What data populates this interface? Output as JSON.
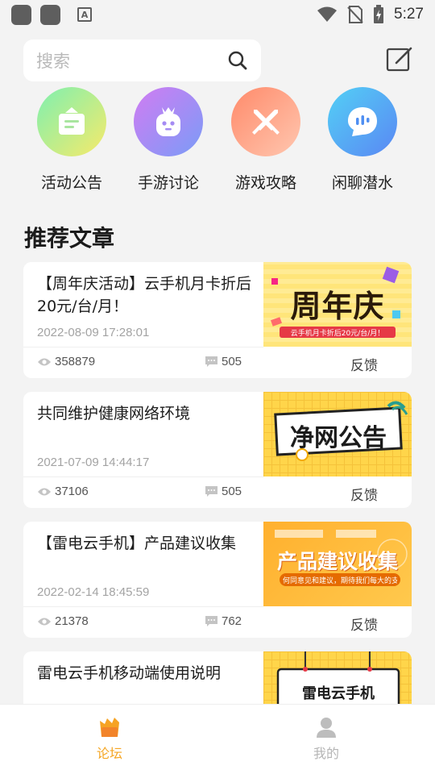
{
  "status_bar": {
    "time": "5:27"
  },
  "search": {
    "placeholder": "搜索"
  },
  "categories": [
    {
      "label": "活动公告",
      "icon": "announcement-icon",
      "colors": [
        "#8cf0a6",
        "#ffe66b"
      ]
    },
    {
      "label": "手游讨论",
      "icon": "game-mascot-icon",
      "colors": [
        "#c57cf5",
        "#7c9bf7"
      ]
    },
    {
      "label": "游戏攻略",
      "icon": "crossed-swords-icon",
      "colors": [
        "#ff9a6e",
        "#ffb9a3"
      ]
    },
    {
      "label": "闲聊潜水",
      "icon": "chat-bubble-icon",
      "colors": [
        "#4fc3f7",
        "#5b8df5"
      ]
    }
  ],
  "section_title": "推荐文章",
  "articles": [
    {
      "title": "【周年庆活动】云手机月卡折后20元/台/月！",
      "date": "2022-08-09 17:28:01",
      "views": "358879",
      "comments": "505",
      "feedback": "反馈",
      "thumb_text": "周年庆",
      "thumb_sub": "云手机月卡折后20元/台/月！"
    },
    {
      "title": "共同维护健康网络环境",
      "date": "2021-07-09 14:44:17",
      "views": "37106",
      "comments": "505",
      "feedback": "反馈",
      "thumb_text": "净网公告"
    },
    {
      "title": "【雷电云手机】产品建议收集",
      "date": "2022-02-14 18:45:59",
      "views": "21378",
      "comments": "762",
      "feedback": "反馈",
      "thumb_text": "产品建议收集",
      "thumb_sub": "何同意见和建议，期待我们每大的支持"
    },
    {
      "title": "雷电云手机移动端使用说明",
      "thumb_text": "雷电云手机"
    }
  ],
  "bottom_nav": [
    {
      "label": "论坛",
      "icon": "forum-icon",
      "active": true
    },
    {
      "label": "我的",
      "icon": "profile-icon",
      "active": false
    }
  ],
  "colors": {
    "accent": "#f5a623",
    "inactive": "#b5b5b5"
  }
}
